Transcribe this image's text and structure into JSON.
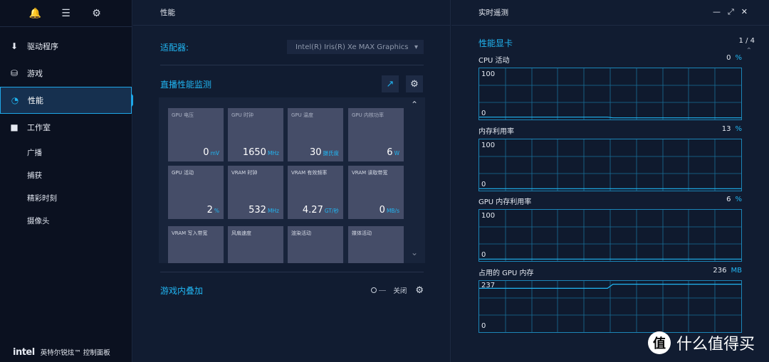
{
  "sidebar": {
    "top_icons": [
      "bell-icon",
      "menu-icon",
      "gear-icon"
    ],
    "items": [
      {
        "label": "驱动程序",
        "icon": "download-icon"
      },
      {
        "label": "游戏",
        "icon": "gamepad-icon"
      },
      {
        "label": "性能",
        "icon": "gauge-icon",
        "active": true
      },
      {
        "label": "工作室",
        "icon": "camera-icon"
      }
    ],
    "sub_items": [
      "广播",
      "捕获",
      "精彩时刻",
      "摄像头"
    ],
    "brand": {
      "logo": "intel",
      "name": "英特尔锐炫™ 控制面板"
    }
  },
  "middle": {
    "title": "性能",
    "adapter_label": "适配器:",
    "adapter_value": "Intel(R) Iris(R) Xe MAX Graphics",
    "monitor_title": "直播性能监测",
    "tiles": [
      {
        "label": "GPU 电压",
        "value": "0",
        "unit": "mV"
      },
      {
        "label": "GPU 时钟",
        "value": "1650",
        "unit": "MHz"
      },
      {
        "label": "GPU 温度",
        "value": "30",
        "unit": "摄氏度"
      },
      {
        "label": "GPU 内核功率",
        "value": "6",
        "unit": "W"
      },
      {
        "label": "GPU 活动",
        "value": "2",
        "unit": "%"
      },
      {
        "label": "VRAM 时钟",
        "value": "532",
        "unit": "MHz"
      },
      {
        "label": "VRAM 有效频率",
        "value": "4.27",
        "unit": "GT/秒"
      },
      {
        "label": "VRAM 读取带宽",
        "value": "0",
        "unit": "MB/s"
      },
      {
        "label": "VRAM 写入带宽",
        "value": "",
        "unit": ""
      },
      {
        "label": "风扇速度",
        "value": "",
        "unit": ""
      },
      {
        "label": "渲染活动",
        "value": "",
        "unit": ""
      },
      {
        "label": "媒体活动",
        "value": "",
        "unit": ""
      }
    ],
    "overlay_title": "游戏内叠加",
    "overlay_state": "关闭"
  },
  "right": {
    "title": "实时遥测",
    "section_title": "性能显卡",
    "page_indicator": "1 / 4",
    "metrics": [
      {
        "label": "CPU 活动",
        "value": "0",
        "unit": "%",
        "max": "100",
        "min": "0",
        "series": [
          2,
          2,
          2,
          2,
          2,
          2,
          2,
          2,
          2,
          2,
          2,
          2,
          2,
          2,
          2,
          2,
          2,
          2,
          2,
          2,
          2,
          2,
          2,
          2,
          2,
          0.5,
          0.5,
          0.5,
          0.5,
          0.5,
          0.5,
          0.5,
          0.5,
          0.5,
          0.5,
          0.5,
          0.5,
          0.5,
          0.5,
          0.5,
          0.5,
          0.5,
          0.5,
          0.5,
          0.5,
          0.5,
          0.5,
          0.5,
          0.5,
          0.5
        ]
      },
      {
        "label": "内存利用率",
        "value": "13",
        "unit": "%",
        "max": "100",
        "min": "0",
        "series": [
          1,
          1,
          1,
          1,
          1,
          1,
          1,
          1,
          1,
          1,
          1,
          1,
          1,
          1,
          1,
          1,
          1,
          1,
          1,
          1,
          1,
          1,
          1,
          1,
          1,
          1,
          1,
          1,
          1,
          1,
          1,
          1,
          1,
          1,
          1,
          1,
          1,
          1,
          1,
          1,
          1,
          1,
          1,
          1,
          1,
          1,
          1,
          1,
          1,
          1
        ]
      },
      {
        "label": "GPU 内存利用率",
        "value": "6",
        "unit": "%",
        "max": "100",
        "min": "0",
        "series": [
          1,
          1,
          1,
          1,
          1,
          1,
          1,
          1,
          1,
          1,
          1,
          1,
          1,
          1,
          1,
          1,
          1,
          1,
          1,
          1,
          1,
          1,
          1,
          1,
          1,
          1,
          1,
          1,
          1,
          1,
          1,
          1,
          1,
          1,
          1,
          1,
          1,
          1,
          1,
          1,
          1,
          1,
          1,
          1,
          1,
          1,
          1,
          1,
          1,
          1
        ]
      },
      {
        "label": "占用的 GPU 内存",
        "value": "236",
        "unit": "MB",
        "max": "237",
        "min": "0",
        "series": [
          214,
          214,
          214,
          214,
          214,
          214,
          214,
          214,
          214,
          214,
          214,
          214,
          214,
          214,
          214,
          214,
          214,
          214,
          214,
          214,
          214,
          214,
          214,
          214,
          214,
          235,
          235,
          235,
          235,
          235,
          235,
          235,
          235,
          235,
          235,
          235,
          235,
          235,
          235,
          235,
          235,
          235,
          235,
          235,
          235,
          235,
          235,
          235,
          235,
          235
        ]
      }
    ]
  },
  "watermark": {
    "seal": "值",
    "text": "什么值得买"
  },
  "colors": {
    "accent": "#21b6f3",
    "tile": "#454d68",
    "bg": "#111c31"
  }
}
